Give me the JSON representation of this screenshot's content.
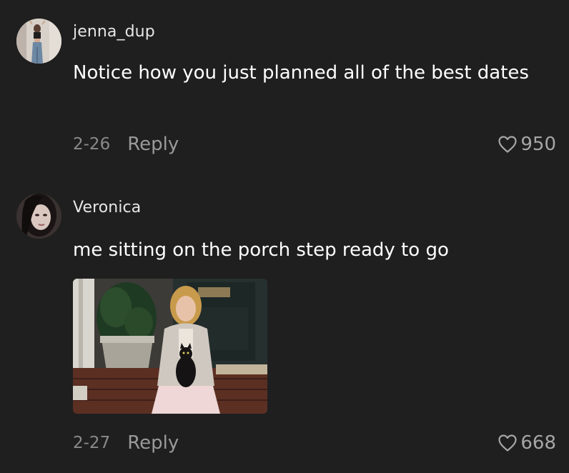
{
  "comments": [
    {
      "username": "jenna_dup",
      "text": "Notice how you just planned all of the best dates",
      "date": "2-26",
      "reply_label": "Reply",
      "likes": "950",
      "avatar_icon": "user-avatar-photo"
    },
    {
      "username": "Veronica",
      "text": "me sitting on the porch step ready to go",
      "date": "2-27",
      "reply_label": "Reply",
      "likes": "668",
      "avatar_icon": "user-avatar-photo",
      "attachment": "gif-image"
    }
  ],
  "colors": {
    "background": "#1f1f1f",
    "text_primary": "#ffffff",
    "text_secondary": "#8a8a8a"
  }
}
